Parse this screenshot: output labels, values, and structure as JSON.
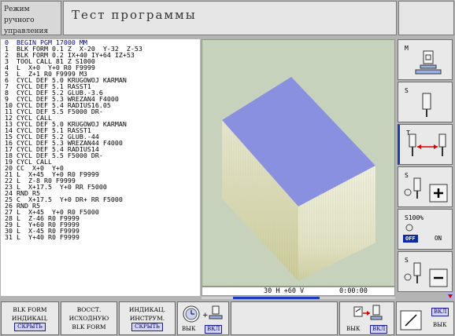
{
  "header": {
    "mode_line1": "Режим ручного",
    "mode_line2": "управления",
    "title": "Тест программы"
  },
  "program": [
    "0  BEGIN PGM 17000 MM",
    "1  BLK FORM 0.1 Z  X-20  Y-32  Z-53",
    "2  BLK FORM 0.2 IX+40 IY+64 IZ+53",
    "3  TOOL CALL 81 Z S1000",
    "4  L  X+0  Y+0 R0 F9999",
    "5  L  Z+1 R0 F9999 M3",
    "6  CYCL DEF 5.0 KRUGOWOJ KARMAN",
    "7  CYCL DEF 5.1 RASST1",
    "8  CYCL DEF 5.2 GLUB.-3.6",
    "9  CYCL DEF 5.3 WREZAN4 F4000",
    "10 CYCL DEF 5.4 RADIUS16.05",
    "11 CYCL DEF 5.5 F5000 DR-",
    "12 CYCL CALL",
    "13 CYCL DEF 5.0 KRUGOWOJ KARMAN",
    "14 CYCL DEF 5.1 RASST1",
    "15 CYCL DEF 5.2 GLUB.-44",
    "16 CYCL DEF 5.3 WREZAN44 F4000",
    "17 CYCL DEF 5.4 RADIUS14",
    "18 CYCL DEF 5.5 F5000 DR-",
    "19 CYCL CALL",
    "20 CC  X+0  Y+0",
    "21 L  X+45  Y+0 R0 F9999",
    "22 L  Z-8 R0 F9999",
    "23 L  X+17.5  Y+0 RR F5000",
    "24 RND R5",
    "25 C  X+17.5  Y+0 DR+ RR F5000",
    "26 RND R5",
    "27 L  X+45  Y+0 R0 F5000",
    "28 L  Z-46 R0 F9999",
    "29 L  Y+60 R0 F9999",
    "30 L  X-45 R0 F9999",
    "31 L  Y+40 R0 F9999"
  ],
  "status": {
    "position": "30 H +60 V",
    "time": "0:00:00"
  },
  "right_softkeys": {
    "m_label": "M",
    "s1_label": "S",
    "t_label": "T",
    "s2_label": "S",
    "s100_label": "S100%",
    "off_label": "OFF",
    "on_label": "ON",
    "s3_label": "S"
  },
  "bottom_softkeys": {
    "k1_l1": "BLK FORM",
    "k1_l2": "ИНДИКАЦ.",
    "k1_tag": "СКРЫТЬ",
    "k2_l1": "ВОССТ.",
    "k2_l2": "ИСХОДНУЮ",
    "k2_l3": "BLK FORM",
    "k3_l1": "ИНДИКАЦ.",
    "k3_l2": "ИНСТРУМ.",
    "k3_tag": "СКРЫТЬ",
    "k4_off": "ВЫК",
    "k4_on": "ВКЛ",
    "k5_off": "ВЫК",
    "k5_on": "ВКЛ",
    "k6_on": "ВКЛ",
    "k6_off": "ВЫК"
  }
}
